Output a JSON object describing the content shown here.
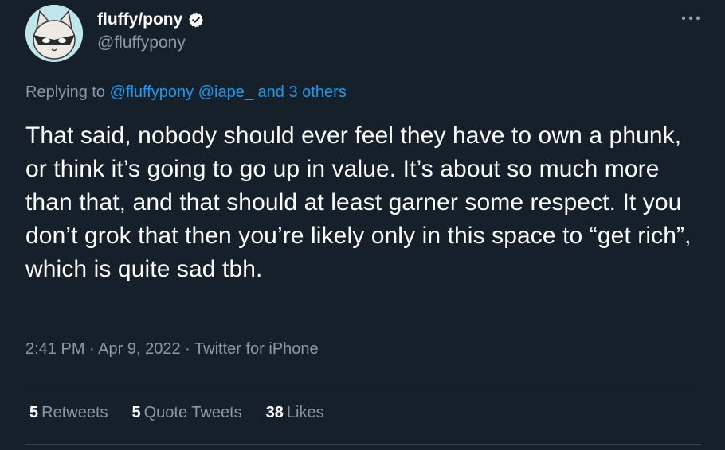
{
  "author": {
    "display_name": "fluffy/pony",
    "handle": "@fluffypony",
    "verified": true
  },
  "reply": {
    "prefix": "Replying to",
    "mention_1": "@fluffypony",
    "mention_2": "@iape_",
    "others": "and 3 others"
  },
  "tweet": {
    "text": "That said, nobody should ever feel they have to own a phunk, or think it’s going to go up in value. It’s about so much more than that, and that should at least garner some respect. It you don’t grok that then you’re likely only in this space to “get rich”, which is quite sad tbh."
  },
  "meta": {
    "time": "2:41 PM",
    "date": "Apr 9, 2022",
    "source": "Twitter for iPhone",
    "separator": "·"
  },
  "stats": {
    "retweets_count": "5",
    "retweets_label": "Retweets",
    "quotes_count": "5",
    "quotes_label": "Quote Tweets",
    "likes_count": "38",
    "likes_label": "Likes"
  },
  "colors": {
    "background": "#15202b",
    "link": "#1d9bf0",
    "secondary_text": "#8b98a5",
    "divider": "#38444d"
  },
  "icons": {
    "verified": "verified-badge-icon",
    "more": "more-options-icon"
  }
}
